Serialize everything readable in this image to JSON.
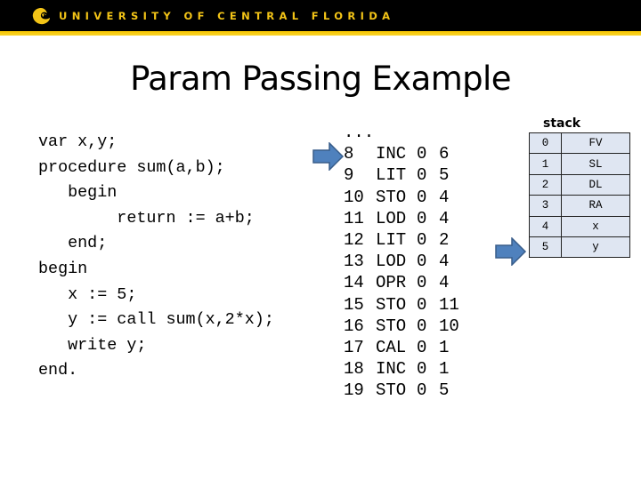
{
  "header": {
    "brand": "UNIVERSITY OF CENTRAL FLORIDA",
    "logo_icon": "ucf-pegasus-logo-icon",
    "colors": {
      "bar": "#000000",
      "gold": "#f3c417",
      "stripe": "#f7c500"
    }
  },
  "slide": {
    "title": "Param Passing Example"
  },
  "source_code": {
    "lines": [
      "var x,y;",
      "procedure sum(a,b);",
      "   begin",
      "        return := a+b;",
      "   end;",
      "begin",
      "   x := 5;",
      "   y := call sum(x,2*x);",
      "   write y;",
      "end."
    ]
  },
  "assembly": {
    "ellipsis": "...",
    "rows": [
      {
        "addr": "8",
        "op": "INC",
        "l": "0",
        "m": "6"
      },
      {
        "addr": "9",
        "op": "LIT",
        "l": "0",
        "m": "5"
      },
      {
        "addr": "10",
        "op": "STO",
        "l": "0",
        "m": "4"
      },
      {
        "addr": "11",
        "op": "LOD",
        "l": "0",
        "m": "4"
      },
      {
        "addr": "12",
        "op": "LIT",
        "l": "0",
        "m": "2"
      },
      {
        "addr": "13",
        "op": "LOD",
        "l": "0",
        "m": "4"
      },
      {
        "addr": "14",
        "op": "OPR",
        "l": "0",
        "m": "4"
      },
      {
        "addr": "15",
        "op": "STO",
        "l": "0",
        "m": "11"
      },
      {
        "addr": "16",
        "op": "STO",
        "l": "0",
        "m": "10"
      },
      {
        "addr": "17",
        "op": "CAL",
        "l": "0",
        "m": "1"
      },
      {
        "addr": "18",
        "op": "INC",
        "l": "0",
        "m": "1"
      },
      {
        "addr": "19",
        "op": "STO",
        "l": "0",
        "m": "5"
      }
    ],
    "pointer": {
      "icon": "right-arrow-icon",
      "points_to_addr": "8"
    }
  },
  "stack": {
    "label": "stack",
    "rows": [
      {
        "index": "0",
        "value": "FV"
      },
      {
        "index": "1",
        "value": "SL"
      },
      {
        "index": "2",
        "value": "DL"
      },
      {
        "index": "3",
        "value": "RA"
      },
      {
        "index": "4",
        "value": "x"
      },
      {
        "index": "5",
        "value": "y"
      }
    ],
    "pointer": {
      "icon": "right-arrow-icon",
      "points_to_index": "5"
    },
    "cell_color": "#dfe6f2",
    "arrow_color": "#4f81bd"
  }
}
